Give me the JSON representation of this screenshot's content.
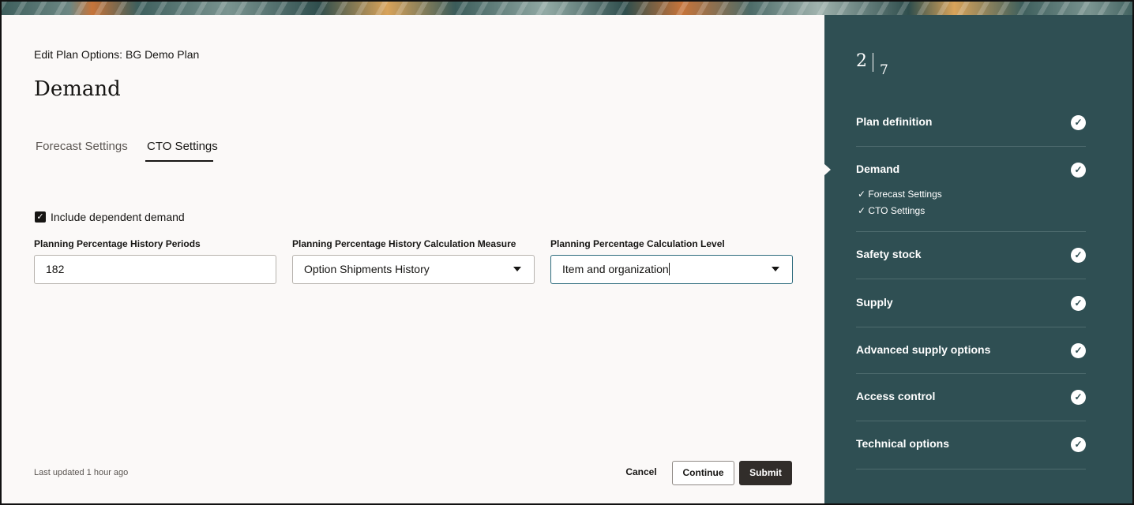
{
  "header": {
    "subtitle": "Edit Plan Options: BG Demo Plan",
    "title": "Demand"
  },
  "tabs": [
    {
      "label": "Forecast Settings",
      "active": false
    },
    {
      "label": "CTO Settings",
      "active": true
    }
  ],
  "form": {
    "include_dependent": {
      "label": "Include dependent demand",
      "checked": true
    },
    "fields": [
      {
        "label": "Planning Percentage History Periods",
        "value": "182",
        "type": "text"
      },
      {
        "label": "Planning Percentage History Calculation Measure",
        "value": "Option Shipments History",
        "type": "select"
      },
      {
        "label": "Planning Percentage Calculation Level",
        "value": "Item and organization",
        "type": "select"
      }
    ]
  },
  "footer": {
    "last_updated": "Last updated 1 hour ago",
    "cancel": "Cancel",
    "continue": "Continue",
    "submit": "Submit"
  },
  "sidebar": {
    "step_current": "2",
    "step_total": "7",
    "items": [
      {
        "label": "Plan definition",
        "completed": true
      },
      {
        "label": "Demand",
        "completed": true,
        "current": true,
        "sub": [
          "Forecast Settings",
          "CTO Settings"
        ]
      },
      {
        "label": "Safety stock",
        "completed": true
      },
      {
        "label": "Supply",
        "completed": true
      },
      {
        "label": "Advanced supply options",
        "completed": true
      },
      {
        "label": "Access control",
        "completed": true
      },
      {
        "label": "Technical options",
        "completed": true
      }
    ],
    "check_glyph": "✓"
  },
  "colors": {
    "sidebar_bg": "#2f4f53",
    "primary_button": "#312d2a",
    "focus_border": "#2d6b7d"
  }
}
